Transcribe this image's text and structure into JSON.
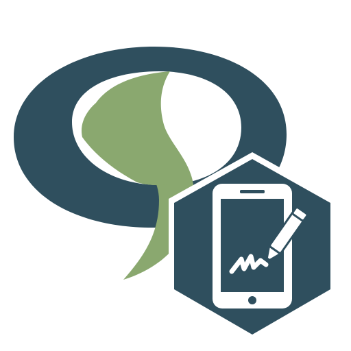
{
  "app_icon": {
    "kind": "app-icon",
    "colors": {
      "background": "#ffffff",
      "ring": "#2f4f5e",
      "swoosh": "#8aa86f",
      "badge": "#2f4f5e",
      "badge_border": "#ffffff",
      "device": "#ffffff",
      "screen": "#2f4f5e",
      "pen": "#ffffff"
    },
    "icons": {
      "logo": "speech-bubble-logo-icon",
      "badge": "hexagon-badge-icon",
      "device": "tablet-icon",
      "pen": "pen-signature-icon"
    }
  }
}
